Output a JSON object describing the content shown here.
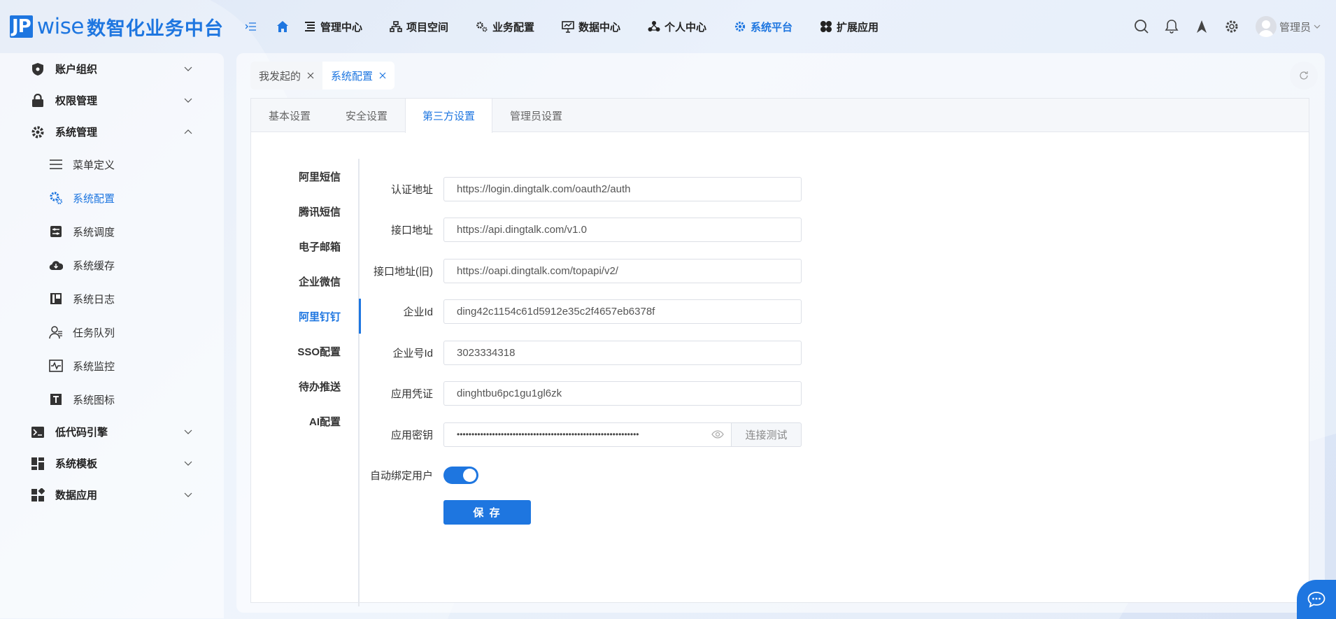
{
  "brand": {
    "mark": "JP",
    "wise": "wise",
    "cn": "数智化业务中台"
  },
  "nav": {
    "items": [
      {
        "label": "管理中心",
        "icon": "list-icon"
      },
      {
        "label": "项目空间",
        "icon": "sitemap-icon"
      },
      {
        "label": "业务配置",
        "icon": "gears-icon"
      },
      {
        "label": "数据中心",
        "icon": "presentation-chart-icon"
      },
      {
        "label": "个人中心",
        "icon": "people-icon"
      },
      {
        "label": "系统平台",
        "icon": "settings-icon",
        "active": true
      },
      {
        "label": "扩展应用",
        "icon": "clover-icon"
      }
    ]
  },
  "user": {
    "name": "管理员"
  },
  "sidebar": {
    "groups": [
      {
        "label": "账户组织",
        "icon": "shield-icon",
        "expanded": false
      },
      {
        "label": "权限管理",
        "icon": "lock-icon",
        "expanded": false
      },
      {
        "label": "系统管理",
        "icon": "gear-icon",
        "expanded": true
      },
      {
        "label": "低代码引擎",
        "icon": "terminal-icon",
        "expanded": false
      },
      {
        "label": "系统模板",
        "icon": "template-icon",
        "expanded": false
      },
      {
        "label": "数据应用",
        "icon": "dashboard-icon",
        "expanded": false
      }
    ],
    "sub_items": [
      {
        "label": "菜单定义",
        "icon": "menu-icon"
      },
      {
        "label": "系统配置",
        "icon": "cog-icon",
        "active": true
      },
      {
        "label": "系统调度",
        "icon": "sliders-icon"
      },
      {
        "label": "系统缓存",
        "icon": "cloud-download-icon"
      },
      {
        "label": "系统日志",
        "icon": "log-icon"
      },
      {
        "label": "任务队列",
        "icon": "user-queue-icon"
      },
      {
        "label": "系统监控",
        "icon": "monitor-icon"
      },
      {
        "label": "系统图标",
        "icon": "text-icon"
      }
    ]
  },
  "tags": [
    {
      "label": "我发起的"
    },
    {
      "label": "系统配置",
      "active": true
    }
  ],
  "tabs": [
    {
      "label": "基本设置"
    },
    {
      "label": "安全设置"
    },
    {
      "label": "第三方设置",
      "active": true
    },
    {
      "label": "管理员设置"
    }
  ],
  "vtabs": [
    {
      "label": "阿里短信"
    },
    {
      "label": "腾讯短信"
    },
    {
      "label": "电子邮箱"
    },
    {
      "label": "企业微信"
    },
    {
      "label": "阿里钉钉",
      "active": true
    },
    {
      "label": "SSO配置"
    },
    {
      "label": "待办推送"
    },
    {
      "label": "AI配置"
    }
  ],
  "form": {
    "auth_url": {
      "label": "认证地址",
      "value": "https://login.dingtalk.com/oauth2/auth"
    },
    "api_url": {
      "label": "接口地址",
      "value": "https://api.dingtalk.com/v1.0"
    },
    "api_url_old": {
      "label": "接口地址(旧)",
      "value": "https://oapi.dingtalk.com/topapi/v2/"
    },
    "corp_id": {
      "label": "企业Id",
      "value": "ding42c1154c61d5912e35c2f4657eb6378f"
    },
    "corp_no": {
      "label": "企业号Id",
      "value": "3023334318"
    },
    "app_key": {
      "label": "应用凭证",
      "value": "dinghtbu6pc1gu1gl6zk"
    },
    "app_secret": {
      "label": "应用密钥",
      "value": "••••••••••••••••••••••••••••••••••••••••••••••••••••••••••••••",
      "test_label": "连接测试"
    },
    "auto_bind": {
      "label": "自动绑定用户",
      "enabled": true
    },
    "save_label": "保 存"
  },
  "colors": {
    "primary": "#1e76e0"
  }
}
